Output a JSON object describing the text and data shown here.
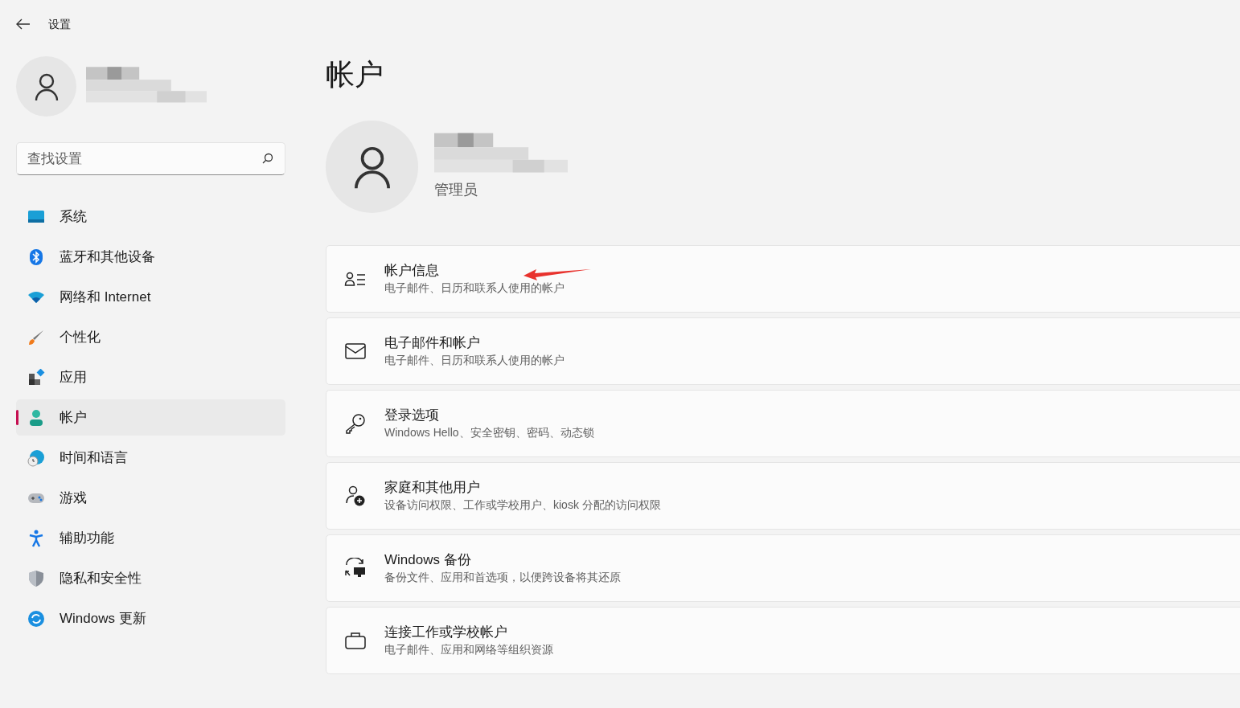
{
  "window": {
    "title": "设置"
  },
  "search": {
    "placeholder": "查找设置"
  },
  "sidebar": {
    "items": [
      {
        "label": "系统",
        "selected": false
      },
      {
        "label": "蓝牙和其他设备",
        "selected": false
      },
      {
        "label": "网络和 Internet",
        "selected": false
      },
      {
        "label": "个性化",
        "selected": false
      },
      {
        "label": "应用",
        "selected": false
      },
      {
        "label": "帐户",
        "selected": true
      },
      {
        "label": "时间和语言",
        "selected": false
      },
      {
        "label": "游戏",
        "selected": false
      },
      {
        "label": "辅助功能",
        "selected": false
      },
      {
        "label": "隐私和安全性",
        "selected": false
      },
      {
        "label": "Windows 更新",
        "selected": false
      }
    ]
  },
  "page": {
    "title": "帐户",
    "role": "管理员"
  },
  "cards": [
    {
      "title": "帐户信息",
      "subtitle": "电子邮件、日历和联系人使用的帐户"
    },
    {
      "title": "电子邮件和帐户",
      "subtitle": "电子邮件、日历和联系人使用的帐户"
    },
    {
      "title": "登录选项",
      "subtitle": "Windows Hello、安全密钥、密码、动态锁"
    },
    {
      "title": "家庭和其他用户",
      "subtitle": "设备访问权限、工作或学校用户、kiosk 分配的访问权限"
    },
    {
      "title": "Windows 备份",
      "subtitle": "备份文件、应用和首选项，以便跨设备将其还原"
    },
    {
      "title": "连接工作或学校帐户",
      "subtitle": "电子邮件、应用和网络等组织资源"
    }
  ]
}
